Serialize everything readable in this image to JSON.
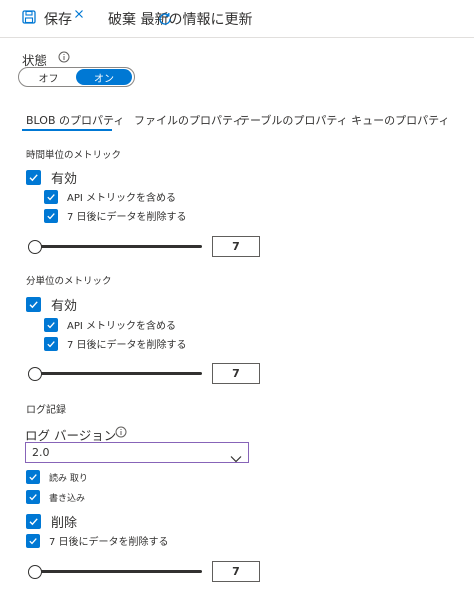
{
  "toolbar": {
    "save_label": "保存",
    "discard_label": "破棄 最新の情報に更新"
  },
  "status": {
    "label": "状態",
    "off_label": "オフ",
    "on_label": "オン"
  },
  "tabs": [
    {
      "label": "BLOB のプロパティ",
      "active": true
    },
    {
      "label": "ファイルのプロパティ",
      "active": false
    },
    {
      "label": "テーブルのプロパティ キューのプロパティ",
      "active": false
    }
  ],
  "hourly_metrics": {
    "heading": "時間単位のメトリック",
    "enabled_label": "有効",
    "include_api_label": "API メトリックを含める",
    "delete_label": "7 日後にデータを削除する",
    "retention_days": "7"
  },
  "minute_metrics": {
    "heading": "分単位のメトリック",
    "enabled_label": "有効",
    "include_api_label": "API メトリックを含める",
    "delete_label": "7 日後にデータを削除する",
    "retention_days": "7"
  },
  "logging": {
    "heading": "ログ記録",
    "version_label": "ログ バージョン",
    "version_value": "2.0",
    "read_label": "読み 取り",
    "write_label": "書き込み",
    "delete_label": "削除",
    "retention_label": "7 日後にデータを削除する",
    "retention_days": "7"
  },
  "colors": {
    "accent": "#0078d4",
    "select_border": "#8764b8",
    "text": "#323130"
  }
}
